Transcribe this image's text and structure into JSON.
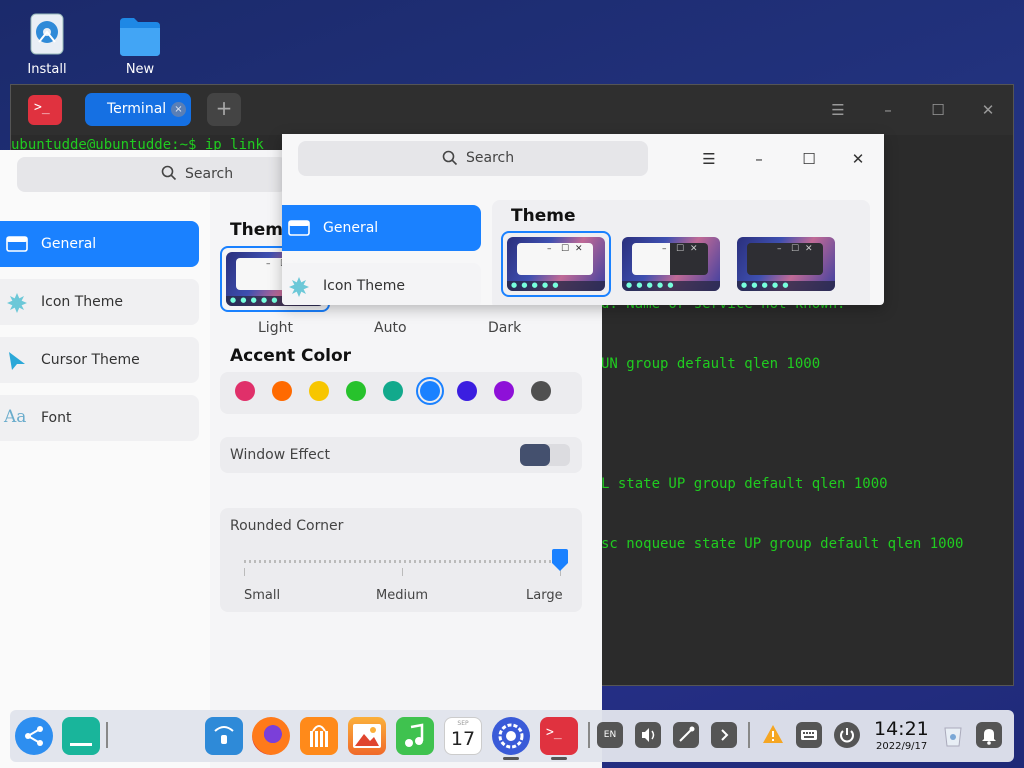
{
  "desktop": {
    "icons": [
      {
        "label": "Install"
      },
      {
        "label": "New"
      }
    ]
  },
  "terminal": {
    "tab_label": "Terminal",
    "tab_close": "×",
    "add_tab": "+",
    "controls": {
      "menu": "☰",
      "minimize": "–",
      "maximize": "☐",
      "close": "✕"
    },
    "lines": [
      "ubuntudde@ubuntudde:~$ ip link",
      "d: Name or service not known.",
      "UN group default qlen 1000",
      "L state UP group default qlen 1000",
      "sc noqueue state UP group default qlen 1000"
    ]
  },
  "settings_back": {
    "search_placeholder": "Search",
    "nav": [
      {
        "label": "General",
        "icon": "general-icon",
        "active": true
      },
      {
        "label": "Icon Theme",
        "icon": "icon-theme-icon",
        "active": false
      },
      {
        "label": "Cursor Theme",
        "icon": "cursor-theme-icon",
        "active": false
      },
      {
        "label": "Font",
        "icon": "font-icon",
        "active": false
      }
    ],
    "theme_title": "Theme",
    "theme_options": [
      {
        "label": "Light",
        "selected": true
      },
      {
        "label": "Auto",
        "selected": false
      },
      {
        "label": "Dark",
        "selected": false
      }
    ],
    "accent_title": "Accent Color",
    "accent_colors": [
      "#e0306a",
      "#ff6a00",
      "#f7c600",
      "#27c22c",
      "#12a98c",
      "#1a81ff",
      "#3b1ee0",
      "#8e10d8",
      "#505050"
    ],
    "accent_selected_index": 5,
    "window_effect_label": "Window Effect",
    "rounded_corner_label": "Rounded Corner",
    "rounded_corner_options": [
      "Small",
      "Medium",
      "Large"
    ],
    "rounded_corner_value": "Large"
  },
  "settings_front": {
    "search_placeholder": "Search",
    "controls": {
      "menu": "☰",
      "minimize": "–",
      "maximize": "☐",
      "close": "✕"
    },
    "nav": [
      {
        "label": "General",
        "active": true
      },
      {
        "label": "Icon Theme",
        "active": false
      }
    ],
    "theme_title": "Theme"
  },
  "dock": {
    "apps": [
      "launcher",
      "multitask-view",
      "app-store",
      "firefox",
      "deepin-store",
      "image-viewer",
      "music",
      "calendar",
      "control-center",
      "terminal"
    ],
    "calendar_month": "SEP",
    "calendar_day": "17",
    "tray": {
      "keyboard_layout": "EN"
    },
    "clock_time": "14:21",
    "clock_date": "2022/9/17"
  },
  "colors": {
    "accent": "#1a81ff",
    "terminal_text": "#20cc20",
    "desktop_bg": "#22327e"
  }
}
